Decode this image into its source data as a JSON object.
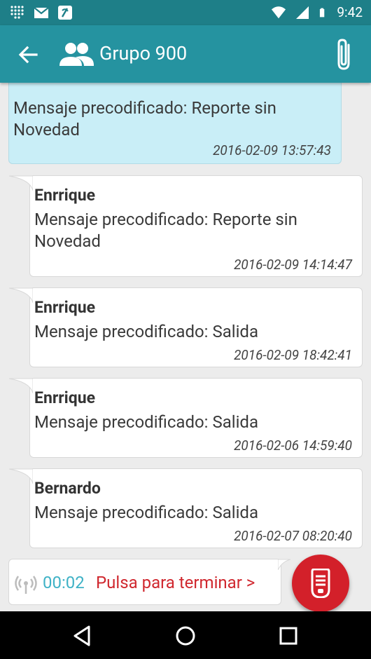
{
  "status_bar": {
    "time": "9:42",
    "left_icons": [
      "grid-icon",
      "gmail-icon",
      "app-icon"
    ],
    "right_icons": [
      "wifi-icon",
      "signal-icon",
      "battery-icon"
    ]
  },
  "app_bar": {
    "title": "Grupo 900",
    "back_icon": "arrow-back-icon",
    "group_icon": "people-icon",
    "attach_icon": "paperclip-icon"
  },
  "messages": [
    {
      "own": true,
      "sender": "",
      "lines": [
        "Mensaje precodificado: Reporte sin",
        "Novedad"
      ],
      "time": "2016-02-09 13:57:43"
    },
    {
      "own": false,
      "sender": "Enrrique",
      "lines": [
        "Mensaje precodificado: Reporte sin",
        "Novedad"
      ],
      "time": "2016-02-09 14:14:47"
    },
    {
      "own": false,
      "sender": "Enrrique",
      "lines": [
        "Mensaje precodificado: Salida"
      ],
      "time": "2016-02-09 18:42:41"
    },
    {
      "own": false,
      "sender": "Enrrique",
      "lines": [
        "Mensaje precodificado: Salida"
      ],
      "time": "2016-02-06 14:59:40"
    },
    {
      "own": false,
      "sender": "Bernardo",
      "lines": [
        "Mensaje precodificado: Salida"
      ],
      "time": "2016-02-07 08:20:40"
    }
  ],
  "ptt": {
    "timer": "00:02",
    "label": "Pulsa para terminar >",
    "timer_color": "#3fb2c6",
    "label_color": "#d0282f",
    "button_color": "#d3202a"
  },
  "colors": {
    "status_bar": "#1e7f88",
    "app_bar": "#2593a0",
    "own_bubble": "#c9eef7",
    "other_bubble": "#ffffff",
    "background": "#ececec"
  }
}
